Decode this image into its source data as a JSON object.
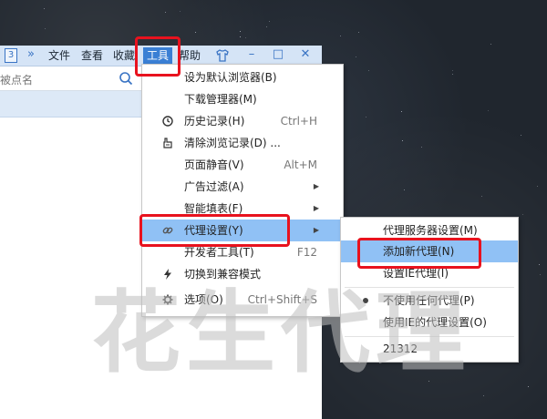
{
  "titlebar": {
    "tab_number": "3",
    "overflow": "»",
    "menus": [
      "文件",
      "查看",
      "收藏",
      "工具",
      "帮助"
    ],
    "active_menu": "工具",
    "shirt_icon": "tshirt-skin-icon",
    "minimize": "–",
    "maximize": "□",
    "close": "✕"
  },
  "address": {
    "placeholder": "被点名"
  },
  "menu": {
    "items": [
      {
        "label": "设为默认浏览器(B)",
        "shortcut": "",
        "icon": ""
      },
      {
        "label": "下载管理器(M)",
        "shortcut": "",
        "icon": ""
      },
      {
        "label": "历史记录(H)",
        "shortcut": "Ctrl+H",
        "icon": "clock-icon"
      },
      {
        "label": "清除浏览记录(D) ...",
        "shortcut": "",
        "icon": "eraser-icon"
      },
      {
        "label": "页面静音(V)",
        "shortcut": "Alt+M",
        "icon": ""
      },
      {
        "label": "广告过滤(A)",
        "shortcut": "",
        "icon": "",
        "submenu": true
      },
      {
        "label": "智能填表(F)",
        "shortcut": "",
        "icon": "",
        "submenu": true
      },
      {
        "label": "代理设置(Y)",
        "shortcut": "",
        "icon": "link-icon",
        "submenu": true,
        "highlighted": true
      },
      {
        "label": "开发者工具(T)",
        "shortcut": "F12",
        "icon": ""
      },
      {
        "label": "切换到兼容模式",
        "shortcut": "",
        "icon": "lightning-icon"
      },
      {
        "label": "选项(O)",
        "shortcut": "Ctrl+Shift+S",
        "icon": "gear-icon"
      }
    ]
  },
  "submenu": {
    "items": [
      {
        "label": "代理服务器设置(M)"
      },
      {
        "label": "添加新代理(N)",
        "highlighted": true
      },
      {
        "label": "设置IE代理(I)"
      },
      {
        "label": "不使用任何代理(P)",
        "selected": true
      },
      {
        "label": "使用IE的代理设置(O)"
      },
      {
        "label": "21312"
      }
    ]
  },
  "watermark": "花生代理",
  "colors": {
    "highlight": "#90c1f5",
    "annotation": "#e8121e",
    "accent": "#3a7fd4"
  }
}
